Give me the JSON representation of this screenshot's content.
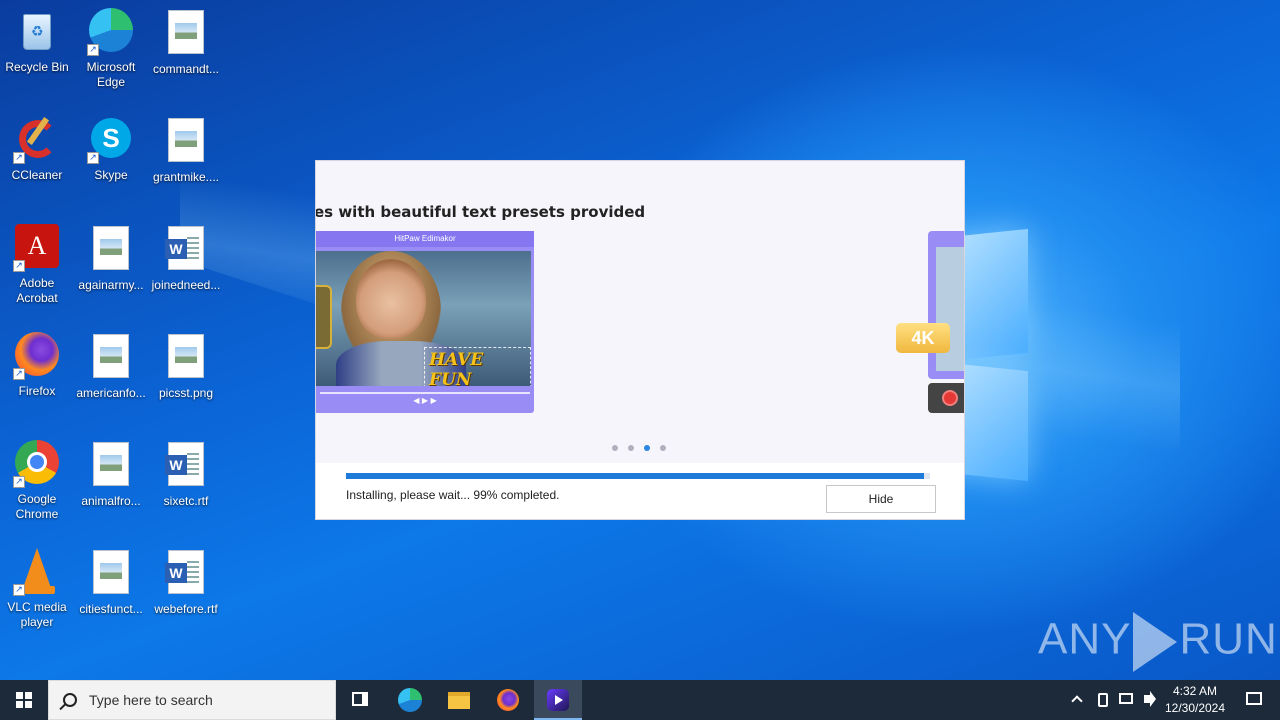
{
  "desktop_icons": [
    {
      "label": "Recycle Bin"
    },
    {
      "label": "Microsoft Edge"
    },
    {
      "label": "commandt..."
    },
    {
      "label": "CCleaner"
    },
    {
      "label": "Skype"
    },
    {
      "label": "grantmike...."
    },
    {
      "label": "Adobe Acrobat"
    },
    {
      "label": "againarmy..."
    },
    {
      "label": "joinedneed..."
    },
    {
      "label": "Firefox"
    },
    {
      "label": "americanfo..."
    },
    {
      "label": "picsst.png"
    },
    {
      "label": "Google Chrome"
    },
    {
      "label": "animalfro..."
    },
    {
      "label": "sixetc.rtf"
    },
    {
      "label": "VLC media player"
    },
    {
      "label": "citiesfunct..."
    },
    {
      "label": "webefore.rtf"
    }
  ],
  "installer": {
    "slide_title": "es with beautiful text presets provided",
    "preview_app_title": "HitPaw Edimakor",
    "preview_overlay_text": "HAVE FUN",
    "badge": "4K",
    "carousel": {
      "count": 4,
      "active_index": 2
    },
    "progress_percent": 99,
    "status_text": "Installing, please wait... 99% completed.",
    "hide_label": "Hide"
  },
  "watermark": {
    "left": "ANY",
    "right": "RUN"
  },
  "taskbar": {
    "search_placeholder": "Type here to search",
    "clock_time": "4:32 AM",
    "clock_date": "12/30/2024"
  },
  "colors": {
    "accent": "#1e7bd9",
    "desktop_blue": "#0b63d4",
    "taskbar": "#1c2a3a"
  }
}
